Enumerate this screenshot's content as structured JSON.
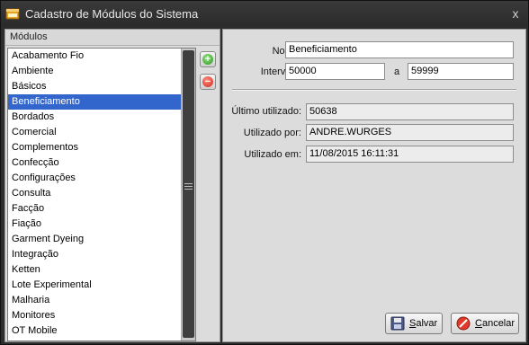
{
  "window": {
    "title": "Cadastro de Módulos do Sistema",
    "close_glyph": "x"
  },
  "left": {
    "header": "Módulos",
    "items": [
      "Acabamento Fio",
      "Ambiente",
      "Básicos",
      "Beneficiamento",
      "Bordados",
      "Comercial",
      "Complementos",
      "Confecção",
      "Configurações",
      "Consulta",
      "Facção",
      "Fiação",
      "Garment Dyeing",
      "Integração",
      "Ketten",
      "Lote Experimental",
      "Malharia",
      "Monitores",
      "OT Mobile"
    ],
    "selected_item": "Beneficiamento",
    "add_icon": "plus-icon",
    "remove_icon": "minus-icon"
  },
  "form": {
    "nome_label": "Nome:",
    "nome_value": "Beneficiamento",
    "intervalo_label": "Intervalo:",
    "intervalo_from": "50000",
    "intervalo_sep": "a",
    "intervalo_to": "59999",
    "ultimo_label": "Último utilizado:",
    "ultimo_value": "50638",
    "utilizado_por_label": "Utilizado por:",
    "utilizado_por_value": "ANDRE.WURGES",
    "utilizado_em_label": "Utilizado em:",
    "utilizado_em_value": "11/08/2015 16:11:31"
  },
  "buttons": {
    "save_mnemonic": "S",
    "save_rest": "alvar",
    "cancel_mnemonic": "C",
    "cancel_rest": "ancelar"
  },
  "colors": {
    "selection": "#3366cc",
    "window_dark": "#2d2d2d",
    "panel": "#dcdcdc"
  }
}
